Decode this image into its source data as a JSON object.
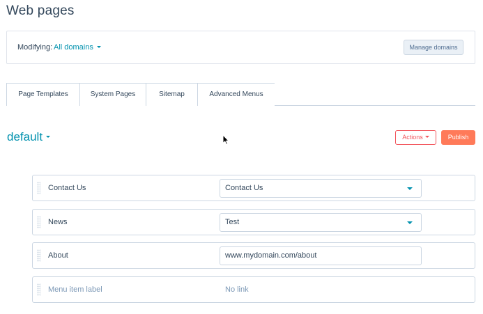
{
  "page": {
    "title": "Web pages"
  },
  "domain_panel": {
    "modifying_label": "Modifying:",
    "selected_domain": "All domains",
    "manage_button": "Manage domains"
  },
  "tabs": [
    {
      "label": "Page Templates"
    },
    {
      "label": "System Pages"
    },
    {
      "label": "Sitemap"
    },
    {
      "label": "Advanced Menus"
    }
  ],
  "menu": {
    "name": "default",
    "actions_label": "Actions",
    "publish_label": "Publish"
  },
  "menu_items": [
    {
      "label": "Contact Us",
      "link": "Contact Us"
    },
    {
      "label": "News",
      "link": "Test"
    },
    {
      "label": "About",
      "link": "www.mydomain.com/about"
    },
    {
      "label": "Menu item label",
      "link": "No link"
    }
  ],
  "icons": {
    "dropdown": "chevron-down-icon",
    "drag": "drag-handle-icon",
    "cursor": "mouse-pointer-icon"
  },
  "colors": {
    "accent_link": "#0091ae",
    "primary_orange": "#ff7a59",
    "actions_red": "#f2545b",
    "border": "#cbd6e2",
    "text": "#33475b",
    "placeholder": "#7c98b6"
  }
}
